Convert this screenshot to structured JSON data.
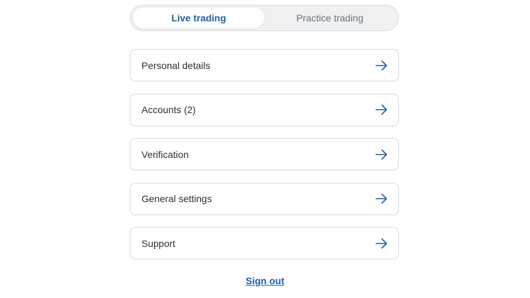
{
  "mode_switch": {
    "tabs": [
      {
        "label": "Live trading",
        "active": true
      },
      {
        "label": "Practice trading",
        "active": false
      }
    ]
  },
  "menu": {
    "items": [
      {
        "label": "Personal details",
        "icon": "arrow-right-icon"
      },
      {
        "label": "Accounts (2)",
        "icon": "arrow-right-icon"
      },
      {
        "label": "Verification",
        "icon": "arrow-right-icon"
      },
      {
        "label": "General settings",
        "icon": "arrow-right-icon"
      },
      {
        "label": "Support",
        "icon": "arrow-right-icon"
      }
    ]
  },
  "footer": {
    "sign_out_label": "Sign out"
  },
  "colors": {
    "accent": "#1f5fa6",
    "border": "#d6d9de",
    "text": "#2b2f33"
  }
}
